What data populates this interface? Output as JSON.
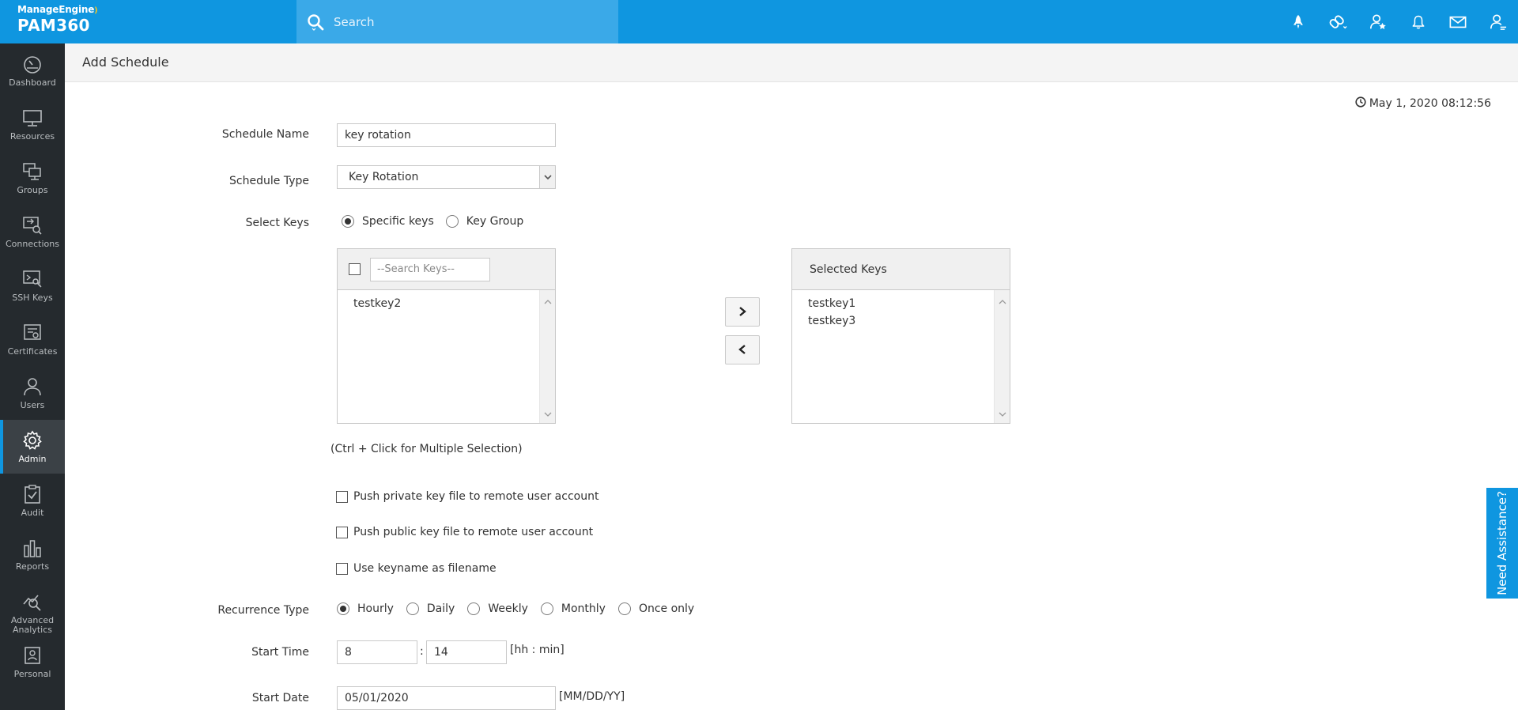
{
  "app": {
    "brand": "ManageEngine",
    "product": "PAM360"
  },
  "search": {
    "placeholder": "Search"
  },
  "top_icons": [
    "rocket-icon",
    "link-settings-icon",
    "user-star-icon",
    "bell-icon",
    "mail-icon",
    "user-settings-icon"
  ],
  "sidebar": {
    "items": [
      {
        "label": "Dashboard",
        "icon": "dashboard-icon"
      },
      {
        "label": "Resources",
        "icon": "monitor-icon"
      },
      {
        "label": "Groups",
        "icon": "groups-icon"
      },
      {
        "label": "Connections",
        "icon": "connections-icon"
      },
      {
        "label": "SSH Keys",
        "icon": "ssh-keys-icon"
      },
      {
        "label": "Certificates",
        "icon": "certificate-icon"
      },
      {
        "label": "Users",
        "icon": "user-icon"
      },
      {
        "label": "Admin",
        "icon": "gear-icon",
        "active": true
      },
      {
        "label": "Audit",
        "icon": "clipboard-check-icon"
      },
      {
        "label": "Reports",
        "icon": "bar-chart-icon"
      },
      {
        "label": "Advanced Analytics",
        "icon": "analytics-icon"
      },
      {
        "label": "Personal",
        "icon": "personal-icon"
      }
    ]
  },
  "page": {
    "title": "Add Schedule",
    "datetime": "May 1, 2020 08:12:56"
  },
  "form": {
    "schedule_name": {
      "label": "Schedule Name",
      "value": "key rotation"
    },
    "schedule_type": {
      "label": "Schedule Type",
      "value": "Key Rotation"
    },
    "select_keys": {
      "label": "Select Keys",
      "options": [
        "Specific keys",
        "Key Group"
      ],
      "selected": "Specific keys"
    },
    "available_keys": {
      "search_placeholder": "--Search Keys--",
      "items": [
        "testkey2"
      ]
    },
    "selected_keys": {
      "header": "Selected Keys",
      "items": [
        "testkey1",
        "testkey3"
      ]
    },
    "hint": "(Ctrl + Click for Multiple Selection)",
    "checkboxes": [
      {
        "label": "Push private key file to remote user account",
        "checked": false
      },
      {
        "label": "Push public key file to remote user account",
        "checked": false
      },
      {
        "label": "Use keyname as filename",
        "checked": false
      }
    ],
    "recurrence": {
      "label": "Recurrence Type",
      "options": [
        "Hourly",
        "Daily",
        "Weekly",
        "Monthly",
        "Once only"
      ],
      "selected": "Hourly"
    },
    "start_time": {
      "label": "Start Time",
      "hour": "8",
      "minute": "14",
      "format": "[hh : min]"
    },
    "start_date": {
      "label": "Start Date",
      "value": "05/01/2020",
      "format": "[MM/DD/YY]"
    }
  },
  "assistance": {
    "label": "Need Assistance?"
  }
}
